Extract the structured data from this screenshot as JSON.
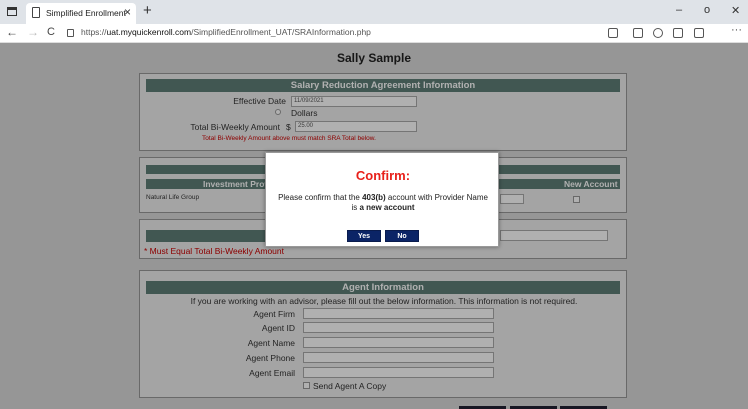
{
  "browser": {
    "tab_title": "Simplified Enrollment",
    "tab_close": "×",
    "new_tab": "+",
    "url_prefix": "https://",
    "url_host": "uat.myquickenroll.com",
    "url_path": "/SimplifiedEnrollment_UAT/SRAInformation.php",
    "back": "←",
    "forward": "→",
    "refresh": "C",
    "minimize": "–",
    "maximize": "o",
    "close": "✕",
    "more": "···"
  },
  "page": {
    "title": "Sally Sample"
  },
  "sra": {
    "header": "Salary Reduction Agreement Information",
    "effective_date_label": "Effective Date",
    "effective_date_value": "11/09/2021",
    "dollars_label": "Dollars",
    "total_label": "Total Bi-Weekly Amount",
    "currency": "$",
    "total_value": "25.00",
    "warning": "Total Bi-Weekly Amount above must match SRA Total below."
  },
  "investment": {
    "col_provider": "Investment Provider",
    "col_new_account": "New Account",
    "row_provider": "Natural Life Group"
  },
  "totals": {
    "must_equal": "* Must Equal Total Bi-Weekly Amount"
  },
  "agent": {
    "header": "Agent Information",
    "note": "If you are working with an advisor, please fill out the below information. This information is not required.",
    "firm_label": "Agent Firm",
    "id_label": "Agent ID",
    "name_label": "Agent Name",
    "phone_label": "Agent Phone",
    "email_label": "Agent Email",
    "send_copy_label": "Send Agent A Copy"
  },
  "modal": {
    "title": "Confirm:",
    "line1_pre": "Please confirm that the ",
    "line1_bold": "403(b)",
    "line1_post": " account with Provider Name",
    "line2_pre": "is ",
    "line2_bold": "a new account",
    "yes_label": "Yes",
    "no_label": "No"
  }
}
